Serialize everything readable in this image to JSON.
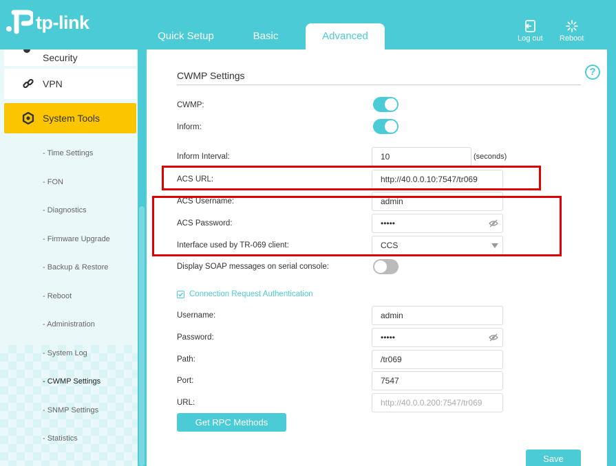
{
  "header": {
    "brand": "tp-link",
    "tabs": [
      "Quick Setup",
      "Basic",
      "Advanced"
    ],
    "logout_label": "Log out",
    "reboot_label": "Reboot"
  },
  "sidebar": {
    "items": [
      "Security",
      "VPN",
      "System Tools"
    ],
    "subitems": [
      "- Time Settings",
      "- FON",
      "- Diagnostics",
      "- Firmware Upgrade",
      "- Backup & Restore",
      "- Reboot",
      "- Administration",
      "- System Log",
      "- CWMP Settings",
      "- SNMP Settings",
      "- Statistics"
    ],
    "active_subitem": "- CWMP Settings"
  },
  "main": {
    "title": "CWMP Settings",
    "cwmp_label": "CWMP:",
    "cwmp_on": true,
    "inform_label": "Inform:",
    "inform_on": true,
    "inform_interval_label": "Inform Interval:",
    "inform_interval_value": "10",
    "inform_interval_unit": "(seconds)",
    "acs_url_label": "ACS URL:",
    "acs_url_value": "http://40.0.0.10:7547/tr069",
    "acs_username_label": "ACS Username:",
    "acs_username_value": "admin",
    "acs_password_label": "ACS Password:",
    "acs_password_value": "•••••",
    "interface_label": "Interface used by TR-069 client:",
    "interface_value": "CCS",
    "soap_label": "Display SOAP messages on serial console:",
    "soap_on": false,
    "conn_auth_label": "Connection Request Authentication",
    "username_label": "Username:",
    "username_value": "admin",
    "password_label": "Password:",
    "password_value": "•••••",
    "path_label": "Path:",
    "path_value": "/tr069",
    "port_label": "Port:",
    "port_value": "7547",
    "url_label": "URL:",
    "url_placeholder": "http://40.0.0.200:7547/tr069",
    "rpc_button": "Get RPC Methods",
    "save_button": "Save"
  },
  "colors": {
    "accent": "#4acbd6",
    "active_menu": "#fbc600",
    "highlight": "#e00000"
  }
}
